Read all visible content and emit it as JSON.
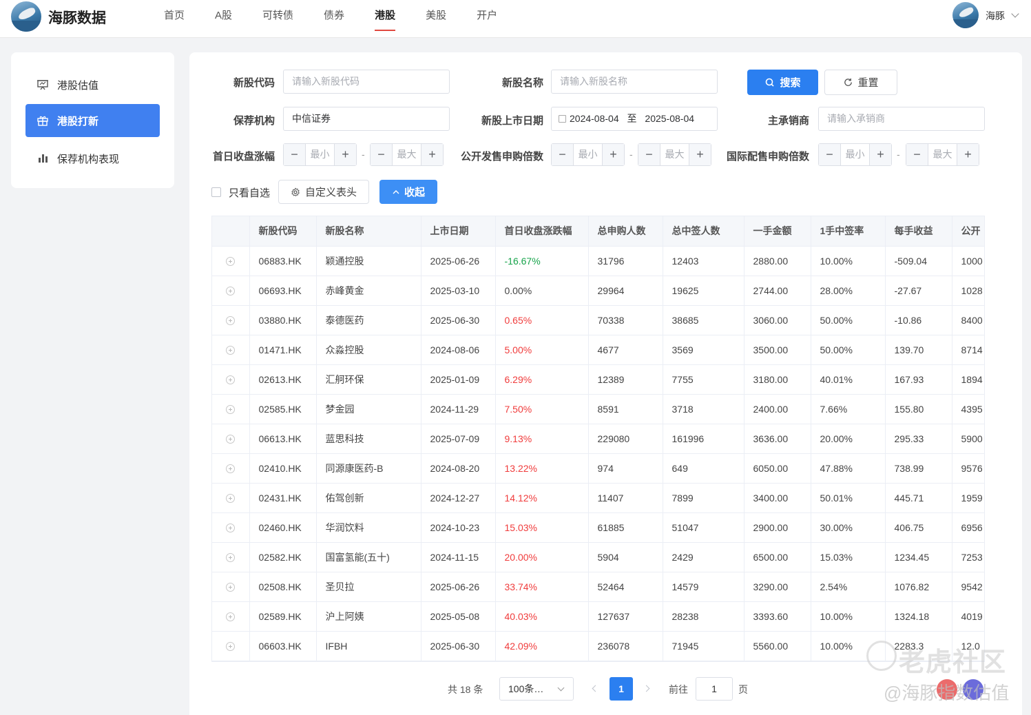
{
  "brand": {
    "name": "海豚数据"
  },
  "nav": {
    "items": [
      "首页",
      "A股",
      "可转债",
      "债券",
      "港股",
      "美股",
      "开户"
    ],
    "active_index": 4
  },
  "user": {
    "name": "海豚"
  },
  "sidebar": {
    "items": [
      {
        "label": "港股估值",
        "icon": "presentation-icon",
        "active": false
      },
      {
        "label": "港股打新",
        "icon": "gift-icon",
        "active": true
      },
      {
        "label": "保荐机构表现",
        "icon": "bar-chart-icon",
        "active": false
      }
    ]
  },
  "filters": {
    "code": {
      "label": "新股代码",
      "placeholder": "请输入新股代码"
    },
    "name": {
      "label": "新股名称",
      "placeholder": "请输入新股名称"
    },
    "search_button": "搜索",
    "reset_button": "重置",
    "sponsor": {
      "label": "保荐机构",
      "value": "中信证券"
    },
    "list_date": {
      "label": "新股上市日期",
      "start": "2024-08-04",
      "separator": "至",
      "end": "2025-08-04"
    },
    "underwriter": {
      "label": "主承销商",
      "placeholder": "请输入承销商"
    },
    "first_day_change": {
      "label": "首日收盘涨幅",
      "min_placeholder": "最小",
      "max_placeholder": "最大"
    },
    "public_subscription": {
      "label": "公开发售申购倍数",
      "min_placeholder": "最小",
      "max_placeholder": "最大"
    },
    "intl_placement": {
      "label": "国际配售申购倍数",
      "min_placeholder": "最小",
      "max_placeholder": "最大"
    },
    "range_dash": "-",
    "only_watchlist": "只看自选",
    "custom_columns": "自定义表头",
    "collapse": "收起"
  },
  "table": {
    "columns": [
      "新股代码",
      "新股名称",
      "上市日期",
      "首日收盘涨跌幅",
      "总申购人数",
      "总中签人数",
      "一手金额",
      "1手中签率",
      "每手收益",
      "公开"
    ],
    "rows": [
      [
        "06883.HK",
        "颖通控股",
        "2025-06-26",
        "-16.67%",
        "31796",
        "12403",
        "2880.00",
        "10.00%",
        "-509.04",
        "1000"
      ],
      [
        "06693.HK",
        "赤峰黄金",
        "2025-03-10",
        "0.00%",
        "29964",
        "19625",
        "2744.00",
        "28.00%",
        "-27.67",
        "1028"
      ],
      [
        "03880.HK",
        "泰德医药",
        "2025-06-30",
        "0.65%",
        "70338",
        "38685",
        "3060.00",
        "50.00%",
        "-10.86",
        "8400"
      ],
      [
        "01471.HK",
        "众淼控股",
        "2024-08-06",
        "5.00%",
        "4677",
        "3569",
        "3500.00",
        "50.00%",
        "139.70",
        "8714"
      ],
      [
        "02613.HK",
        "汇舸环保",
        "2025-01-09",
        "6.29%",
        "12389",
        "7755",
        "3180.00",
        "40.01%",
        "167.93",
        "1894"
      ],
      [
        "02585.HK",
        "梦金园",
        "2024-11-29",
        "7.50%",
        "8591",
        "3718",
        "2400.00",
        "7.66%",
        "155.80",
        "4395"
      ],
      [
        "06613.HK",
        "蓝思科技",
        "2025-07-09",
        "9.13%",
        "229080",
        "161996",
        "3636.00",
        "20.00%",
        "295.33",
        "5900"
      ],
      [
        "02410.HK",
        "同源康医药-B",
        "2024-08-20",
        "13.22%",
        "974",
        "649",
        "6050.00",
        "47.88%",
        "738.99",
        "9576"
      ],
      [
        "02431.HK",
        "佑驾创新",
        "2024-12-27",
        "14.12%",
        "11407",
        "7899",
        "3400.00",
        "50.01%",
        "445.71",
        "1959"
      ],
      [
        "02460.HK",
        "华润饮料",
        "2024-10-23",
        "15.03%",
        "61885",
        "51047",
        "2900.00",
        "30.00%",
        "406.75",
        "6956"
      ],
      [
        "02582.HK",
        "国富氢能(五十)",
        "2024-11-15",
        "20.00%",
        "5904",
        "2429",
        "6500.00",
        "15.03%",
        "1234.45",
        "7253"
      ],
      [
        "02508.HK",
        "圣贝拉",
        "2025-06-26",
        "33.74%",
        "52464",
        "14579",
        "3290.00",
        "2.54%",
        "1076.82",
        "9542"
      ],
      [
        "02589.HK",
        "沪上阿姨",
        "2025-05-08",
        "40.03%",
        "127637",
        "28238",
        "3393.60",
        "10.00%",
        "1324.18",
        "4019"
      ],
      [
        "06603.HK",
        "IFBH",
        "2025-06-30",
        "42.09%",
        "236078",
        "71945",
        "5560.00",
        "10.00%",
        "2283.3",
        "12.0"
      ]
    ],
    "change_directions": [
      "down",
      "flat",
      "up",
      "up",
      "up",
      "up",
      "up",
      "up",
      "up",
      "up",
      "up",
      "up",
      "up",
      "up"
    ]
  },
  "pagination": {
    "total": "共 18 条",
    "page_size": "100条…",
    "current_page": "1",
    "goto_label": "前往",
    "goto_value": "1",
    "page_suffix": "页"
  },
  "watermark": {
    "line1": "老虎社区",
    "line2": "@海豚指数估值"
  },
  "colors": {
    "primary": "#2b7ff0",
    "up": "#f03c3c",
    "down": "#16a34a",
    "nav_underline": "#e0483f"
  }
}
